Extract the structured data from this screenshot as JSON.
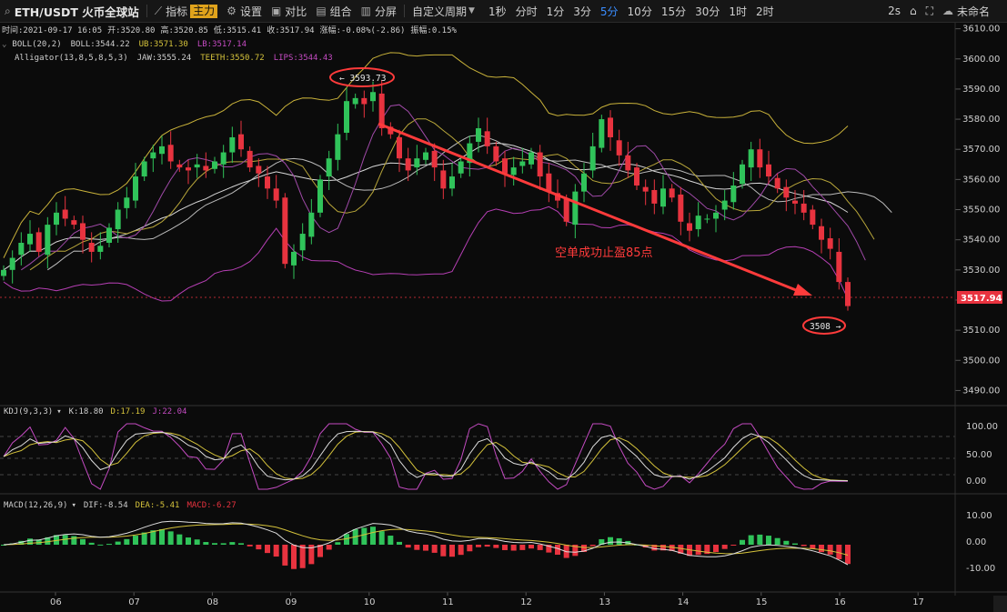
{
  "toolbar": {
    "symbol": "ETH/USDT 火币全球站",
    "indicators": "指标",
    "main_badge": "主力",
    "settings": "设置",
    "compare": "对比",
    "combine": "组合",
    "split": "分屏",
    "custom_period": "自定义周期",
    "periods": [
      "1秒",
      "分时",
      "1分",
      "3分",
      "5分",
      "10分",
      "15分",
      "30分",
      "1时",
      "2时"
    ],
    "active_period": "5分",
    "refresh": "2s",
    "layout_name": "未命名"
  },
  "info": {
    "time": "时间:2021-09-17 16:05",
    "open": "开:3520.80",
    "high": "高:3520.85",
    "low": "低:3515.41",
    "close": "收:3517.94",
    "change": "涨幅:-0.08%(-2.86)",
    "amplitude": "振幅:0.15%"
  },
  "legends": {
    "boll": {
      "name": "BOLL(20,2)",
      "mid": "BOLL:3544.22",
      "ub": "UB:3571.30",
      "lb": "LB:3517.14"
    },
    "alligator": {
      "name": "Alligator(13,8,5,8,5,3)",
      "jaw": "JAW:3555.24",
      "teeth": "TEETH:3550.72",
      "lips": "LIPS:3544.43"
    },
    "kdj": {
      "name": "KDJ(9,3,3)",
      "k": "K:18.80",
      "d": "D:17.19",
      "j": "J:22.04"
    },
    "macd": {
      "name": "MACD(12,26,9)",
      "dif": "DIF:-8.54",
      "dea": "DEA:-5.41",
      "macd": "MACD:-6.27"
    }
  },
  "annotations": {
    "high_marker": "3593.73",
    "low_marker": "3508",
    "note": "空单成功止盈85点",
    "last_price": "3517.94"
  },
  "colors": {
    "up": "#30c35a",
    "down": "#e8333f",
    "boll": "#c9b23a",
    "lb": "#b63fb4",
    "annotation": "#ff3b3b",
    "accent": "#3a8dff"
  },
  "chart_data": {
    "type": "candlestick",
    "x_ticks": [
      "06",
      "07",
      "08",
      "09",
      "10",
      "11",
      "12",
      "13",
      "14",
      "15",
      "16",
      "17"
    ],
    "price_ticks": [
      3490,
      3500,
      3510,
      3520,
      3530,
      3540,
      3550,
      3560,
      3570,
      3580,
      3590,
      3600,
      3610
    ],
    "price_range": [
      3485,
      3612
    ],
    "kdj_ticks": [
      "100.00",
      "50.00",
      "0.00"
    ],
    "macd_ticks": [
      "10.00",
      "0.00",
      "-10.00"
    ],
    "closes": [
      3530,
      3534,
      3539,
      3542,
      3536,
      3545,
      3549,
      3547,
      3545,
      3540,
      3536,
      3538,
      3544,
      3550,
      3554,
      3561,
      3566,
      3569,
      3571,
      3566,
      3564,
      3563,
      3565,
      3563,
      3566,
      3569,
      3574,
      3570,
      3564,
      3562,
      3557,
      3553,
      3532,
      3536,
      3542,
      3549,
      3560,
      3567,
      3575,
      3586,
      3587,
      3585,
      3589,
      3577,
      3575,
      3567,
      3563,
      3567,
      3569,
      3564,
      3557,
      3561,
      3566,
      3572,
      3577,
      3571,
      3566,
      3562,
      3564,
      3566,
      3569,
      3561,
      3556,
      3553,
      3546,
      3556,
      3562,
      3571,
      3580,
      3574,
      3568,
      3563,
      3558,
      3556,
      3552,
      3557,
      3554,
      3546,
      3543,
      3548,
      3547,
      3549,
      3553,
      3558,
      3565,
      3570,
      3564,
      3561,
      3557,
      3554,
      3552,
      3549,
      3545,
      3540,
      3537,
      3526,
      3518
    ]
  }
}
